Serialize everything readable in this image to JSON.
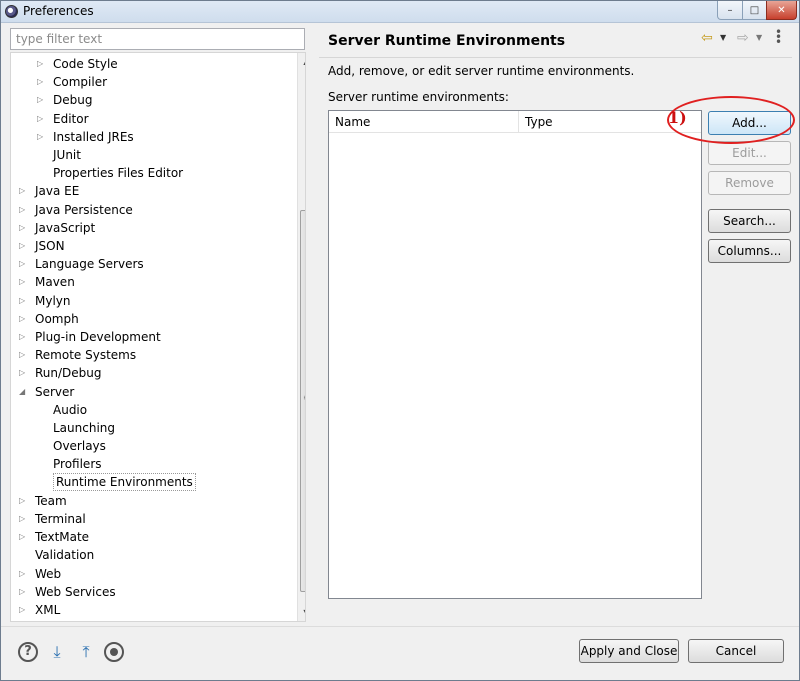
{
  "window": {
    "title": "Preferences",
    "minimize": "–",
    "maximize": "□",
    "close": "✕"
  },
  "filter": {
    "placeholder": "type filter text"
  },
  "tree": {
    "items": [
      {
        "label": "Code Style",
        "level": 2,
        "arrow": "▷"
      },
      {
        "label": "Compiler",
        "level": 2,
        "arrow": "▷"
      },
      {
        "label": "Debug",
        "level": 2,
        "arrow": "▷"
      },
      {
        "label": "Editor",
        "level": 2,
        "arrow": "▷"
      },
      {
        "label": "Installed JREs",
        "level": 2,
        "arrow": "▷"
      },
      {
        "label": "JUnit",
        "level": 2,
        "arrow": ""
      },
      {
        "label": "Properties Files Editor",
        "level": 2,
        "arrow": ""
      },
      {
        "label": "Java EE",
        "level": 1,
        "arrow": "▷"
      },
      {
        "label": "Java Persistence",
        "level": 1,
        "arrow": "▷"
      },
      {
        "label": "JavaScript",
        "level": 1,
        "arrow": "▷"
      },
      {
        "label": "JSON",
        "level": 1,
        "arrow": "▷"
      },
      {
        "label": "Language Servers",
        "level": 1,
        "arrow": "▷"
      },
      {
        "label": "Maven",
        "level": 1,
        "arrow": "▷"
      },
      {
        "label": "Mylyn",
        "level": 1,
        "arrow": "▷"
      },
      {
        "label": "Oomph",
        "level": 1,
        "arrow": "▷"
      },
      {
        "label": "Plug-in Development",
        "level": 1,
        "arrow": "▷"
      },
      {
        "label": "Remote Systems",
        "level": 1,
        "arrow": "▷"
      },
      {
        "label": "Run/Debug",
        "level": 1,
        "arrow": "▷"
      },
      {
        "label": "Server",
        "level": 1,
        "arrow": "◢"
      },
      {
        "label": "Audio",
        "level": 2,
        "arrow": ""
      },
      {
        "label": "Launching",
        "level": 2,
        "arrow": ""
      },
      {
        "label": "Overlays",
        "level": 2,
        "arrow": ""
      },
      {
        "label": "Profilers",
        "level": 2,
        "arrow": ""
      },
      {
        "label": "Runtime Environments",
        "level": 2,
        "arrow": "",
        "selected": true
      },
      {
        "label": "Team",
        "level": 1,
        "arrow": "▷"
      },
      {
        "label": "Terminal",
        "level": 1,
        "arrow": "▷"
      },
      {
        "label": "TextMate",
        "level": 1,
        "arrow": "▷"
      },
      {
        "label": "Validation",
        "level": 1,
        "arrow": ""
      },
      {
        "label": "Web",
        "level": 1,
        "arrow": "▷"
      },
      {
        "label": "Web Services",
        "level": 1,
        "arrow": "▷"
      },
      {
        "label": "XML",
        "level": 1,
        "arrow": "▷"
      }
    ],
    "scroll_up": "▲",
    "scroll_down": "▼"
  },
  "page": {
    "title": "Server Runtime Environments",
    "description": "Add, remove, or edit server runtime environments.",
    "list_label": "Server runtime environments:",
    "columns": [
      "Name",
      "Type"
    ],
    "nav_back": "⇦",
    "nav_fwd": "⇨",
    "dropdown": "▼"
  },
  "buttons": {
    "add": "Add...",
    "edit": "Edit...",
    "remove": "Remove",
    "search": "Search...",
    "columns": "Columns..."
  },
  "annotation": {
    "label": "1)"
  },
  "footer": {
    "help": "?",
    "apply_close": "Apply and Close",
    "cancel": "Cancel"
  }
}
